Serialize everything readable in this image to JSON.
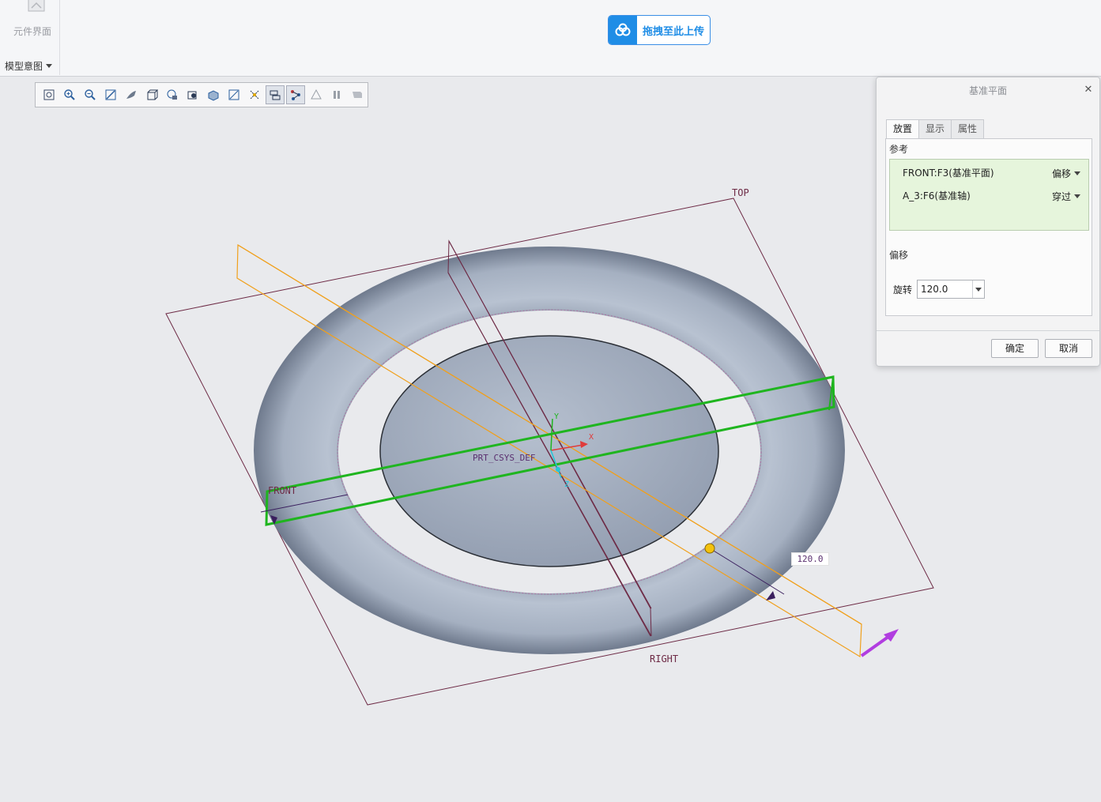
{
  "ribbon": {
    "component_interface_label": "元件界面",
    "model_intent_label": "模型意图"
  },
  "upload": {
    "label": "拖拽至此上传"
  },
  "toolbar": {
    "buttons": [
      "refit-icon",
      "zoom-in-icon",
      "zoom-out-icon",
      "repaint-icon",
      "display-style-icon",
      "saved-views-icon",
      "view-manager-icon",
      "perspective-icon",
      "named-view-icon",
      "section-icon",
      "annotation-display-icon",
      "datum-display-filter-icon",
      "spin-center-icon",
      "simulation-icon",
      "pause-icon",
      "playback-icon"
    ],
    "active": [
      "datum-display-filter-icon",
      "spin-center-icon"
    ]
  },
  "model": {
    "labels": {
      "top": "TOP",
      "front": "FRONT",
      "right": "RIGHT",
      "csys": "PRT_CSYS_DEF"
    },
    "axes": {
      "x": "X",
      "y": "Y",
      "z": "Z"
    },
    "rotation_dimension": "120.0"
  },
  "dialog": {
    "title": "基准平面",
    "tabs": [
      "放置",
      "显示",
      "属性"
    ],
    "active_tab": "放置",
    "references_label": "参考",
    "references": [
      {
        "name": "FRONT:F3(基准平面)",
        "constraint": "偏移"
      },
      {
        "name": "A_3:F6(基准轴)",
        "constraint": "穿过"
      }
    ],
    "offset_label": "偏移",
    "rotation_label": "旋转",
    "rotation_value": "120.0",
    "ok_label": "确定",
    "cancel_label": "取消"
  },
  "colors": {
    "torus": "#a7b2c3",
    "datum_plane": "#6d2a45",
    "selected_plane": "#1fb51f",
    "axis_line": "#f0a01c",
    "drag_arrow": "#b13de0",
    "ref_highlight": "#e6f5dc"
  }
}
